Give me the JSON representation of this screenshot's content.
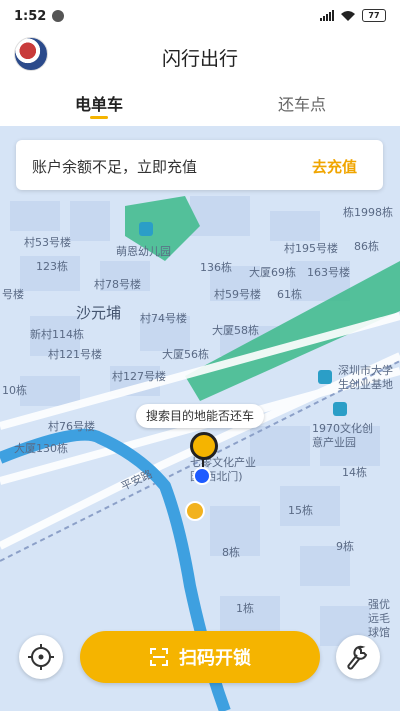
{
  "status_bar": {
    "time": "1:52",
    "battery": "77"
  },
  "header": {
    "title": "闪行出行"
  },
  "tabs": [
    {
      "label": "电单车",
      "active": true
    },
    {
      "label": "还车点",
      "active": false
    }
  ],
  "banner": {
    "message": "账户余额不足，立即充值",
    "action": "去充值"
  },
  "map": {
    "labels": [
      "栋1998栋",
      "萌恩幼儿园",
      "村53号楼",
      "村195号楼",
      "86栋",
      "123栋",
      "136栋",
      "大厦69栋",
      "163号楼",
      "村78号楼",
      "号楼",
      "村59号楼",
      "61栋",
      "沙元埔",
      "村74号楼",
      "新村114栋",
      "大厦58栋",
      "村121号楼",
      "大厦56栋",
      "村127号楼",
      "深圳市大学生创业基地",
      "10栋",
      "1970文化创意产业园",
      "村76号楼",
      "大厦130栋",
      "平安路",
      "七零文化产业园(西北门)",
      "14栋",
      "15栋",
      "9栋",
      "8栋",
      "1栋",
      "强优远毛球馆"
    ],
    "tooltip": "搜索目的地能否还车"
  },
  "actions": {
    "scan_label": "扫码开锁"
  },
  "colors": {
    "accent": "#f5b400",
    "map_bg": "#d6e4f6",
    "water": "#3ea0e0",
    "park": "#3cba8a"
  }
}
